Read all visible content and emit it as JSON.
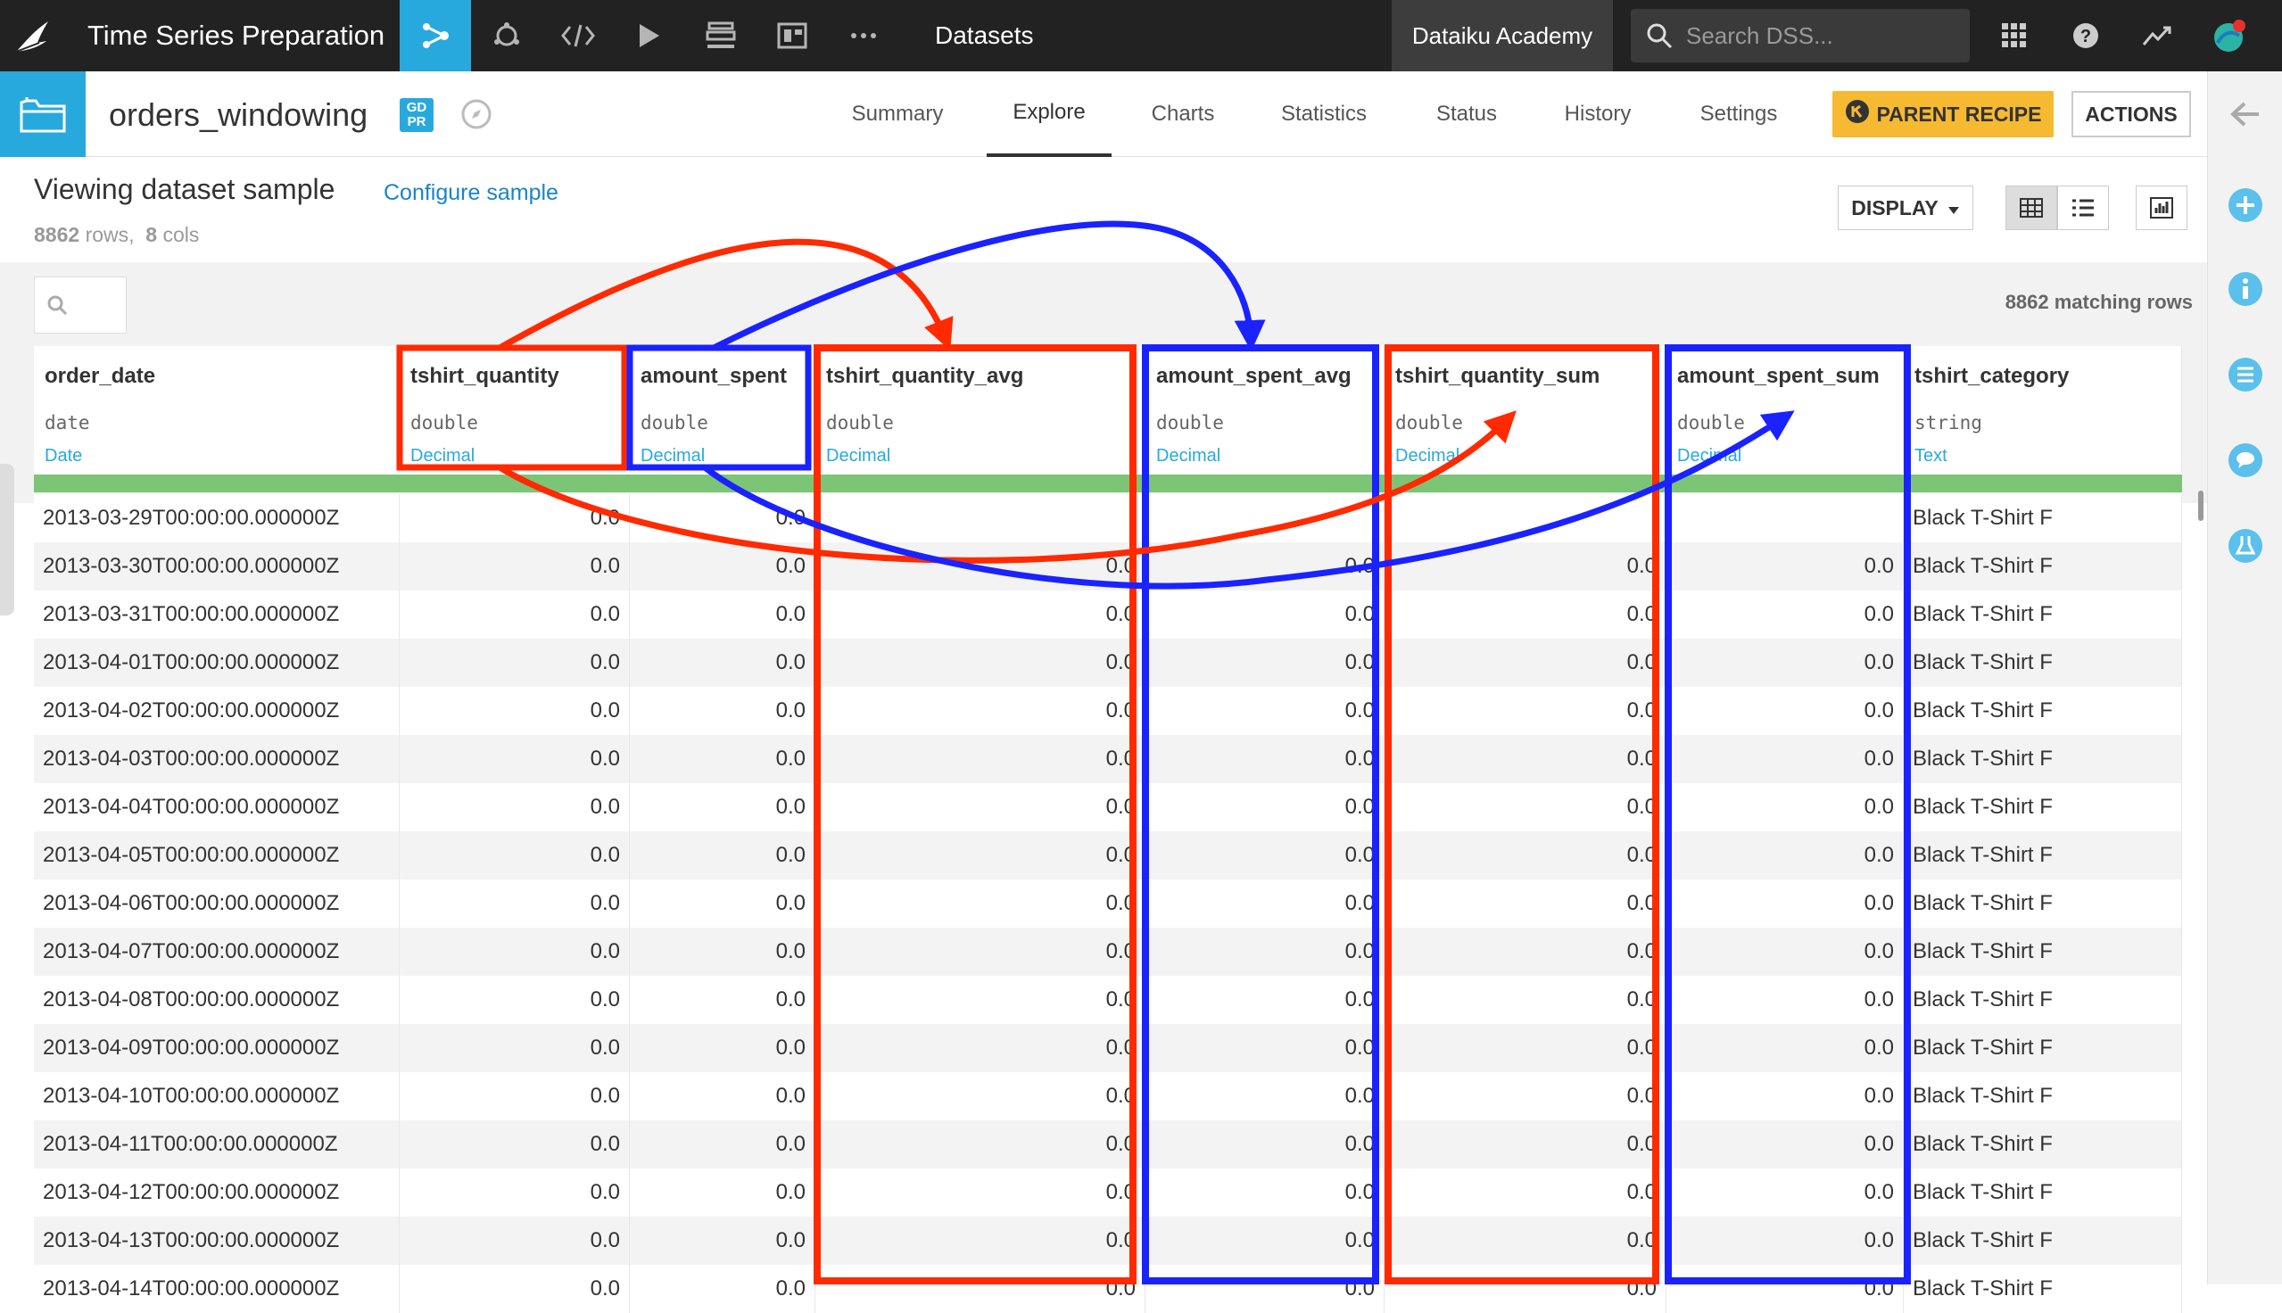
{
  "topbar": {
    "project_title": "Time Series Preparation",
    "datasets_label": "Datasets",
    "academy_label": "Dataiku Academy",
    "search_placeholder": "Search DSS..."
  },
  "subheader": {
    "dataset_name": "orders_windowing",
    "gdpr_badge": "GD\nPR",
    "tabs": [
      "Summary",
      "Explore",
      "Charts",
      "Statistics",
      "Status",
      "History",
      "Settings"
    ],
    "active_tab": "Explore",
    "parent_recipe_label": "PARENT RECIPE",
    "actions_label": "ACTIONS"
  },
  "content": {
    "title": "Viewing dataset sample",
    "configure_link": "Configure sample",
    "rows_count": "8862",
    "rows_label": "rows,",
    "cols_count": "8",
    "cols_label": "cols",
    "display_label": "DISPLAY",
    "matching_rows": "8862 matching rows"
  },
  "columns": [
    {
      "name": "order_date",
      "type": "date",
      "meaning": "Date"
    },
    {
      "name": "tshirt_quantity",
      "type": "double",
      "meaning": "Decimal"
    },
    {
      "name": "amount_spent",
      "type": "double",
      "meaning": "Decimal"
    },
    {
      "name": "tshirt_quantity_avg",
      "type": "double",
      "meaning": "Decimal"
    },
    {
      "name": "amount_spent_avg",
      "type": "double",
      "meaning": "Decimal"
    },
    {
      "name": "tshirt_quantity_sum",
      "type": "double",
      "meaning": "Decimal"
    },
    {
      "name": "amount_spent_sum",
      "type": "double",
      "meaning": "Decimal"
    },
    {
      "name": "tshirt_category",
      "type": "string",
      "meaning": "Text"
    }
  ],
  "rows": [
    [
      "2013-03-29T00:00:00.000000Z",
      "0.0",
      "0.0",
      "",
      "",
      "",
      "",
      "Black T-Shirt F"
    ],
    [
      "2013-03-30T00:00:00.000000Z",
      "0.0",
      "0.0",
      "0.0",
      "0.0",
      "0.0",
      "0.0",
      "Black T-Shirt F"
    ],
    [
      "2013-03-31T00:00:00.000000Z",
      "0.0",
      "0.0",
      "0.0",
      "0.0",
      "0.0",
      "0.0",
      "Black T-Shirt F"
    ],
    [
      "2013-04-01T00:00:00.000000Z",
      "0.0",
      "0.0",
      "0.0",
      "0.0",
      "0.0",
      "0.0",
      "Black T-Shirt F"
    ],
    [
      "2013-04-02T00:00:00.000000Z",
      "0.0",
      "0.0",
      "0.0",
      "0.0",
      "0.0",
      "0.0",
      "Black T-Shirt F"
    ],
    [
      "2013-04-03T00:00:00.000000Z",
      "0.0",
      "0.0",
      "0.0",
      "0.0",
      "0.0",
      "0.0",
      "Black T-Shirt F"
    ],
    [
      "2013-04-04T00:00:00.000000Z",
      "0.0",
      "0.0",
      "0.0",
      "0.0",
      "0.0",
      "0.0",
      "Black T-Shirt F"
    ],
    [
      "2013-04-05T00:00:00.000000Z",
      "0.0",
      "0.0",
      "0.0",
      "0.0",
      "0.0",
      "0.0",
      "Black T-Shirt F"
    ],
    [
      "2013-04-06T00:00:00.000000Z",
      "0.0",
      "0.0",
      "0.0",
      "0.0",
      "0.0",
      "0.0",
      "Black T-Shirt F"
    ],
    [
      "2013-04-07T00:00:00.000000Z",
      "0.0",
      "0.0",
      "0.0",
      "0.0",
      "0.0",
      "0.0",
      "Black T-Shirt F"
    ],
    [
      "2013-04-08T00:00:00.000000Z",
      "0.0",
      "0.0",
      "0.0",
      "0.0",
      "0.0",
      "0.0",
      "Black T-Shirt F"
    ],
    [
      "2013-04-09T00:00:00.000000Z",
      "0.0",
      "0.0",
      "0.0",
      "0.0",
      "0.0",
      "0.0",
      "Black T-Shirt F"
    ],
    [
      "2013-04-10T00:00:00.000000Z",
      "0.0",
      "0.0",
      "0.0",
      "0.0",
      "0.0",
      "0.0",
      "Black T-Shirt F"
    ],
    [
      "2013-04-11T00:00:00.000000Z",
      "0.0",
      "0.0",
      "0.0",
      "0.0",
      "0.0",
      "0.0",
      "Black T-Shirt F"
    ],
    [
      "2013-04-12T00:00:00.000000Z",
      "0.0",
      "0.0",
      "0.0",
      "0.0",
      "0.0",
      "0.0",
      "Black T-Shirt F"
    ],
    [
      "2013-04-13T00:00:00.000000Z",
      "0.0",
      "0.0",
      "0.0",
      "0.0",
      "0.0",
      "0.0",
      "Black T-Shirt F"
    ],
    [
      "2013-04-14T00:00:00.000000Z",
      "0.0",
      "0.0",
      "0.0",
      "0.0",
      "0.0",
      "0.0",
      "Black T-Shirt F"
    ]
  ],
  "colors": {
    "accent": "#28a9dd",
    "annotation_red": "#ff2a00",
    "annotation_blue": "#1a22ff",
    "parent_recipe_bg": "#f6b932",
    "quality_bar": "#7cc576"
  },
  "icons": [
    "dataiku-bird-icon",
    "flow-icon",
    "lab-icon",
    "code-icon",
    "play-icon",
    "deploy-icon",
    "dashboard-icon",
    "more-icon",
    "search-icon",
    "apps-grid-icon",
    "help-icon",
    "activity-icon",
    "avatar-icon",
    "dataset-folder-icon",
    "compass-icon",
    "recipe-icon",
    "caret-down-icon",
    "table-view-icon",
    "list-view-icon",
    "chart-view-icon",
    "back-arrow-icon",
    "plus-circle-icon",
    "info-icon",
    "schema-icon",
    "discussion-icon",
    "lab-circle-icon"
  ]
}
